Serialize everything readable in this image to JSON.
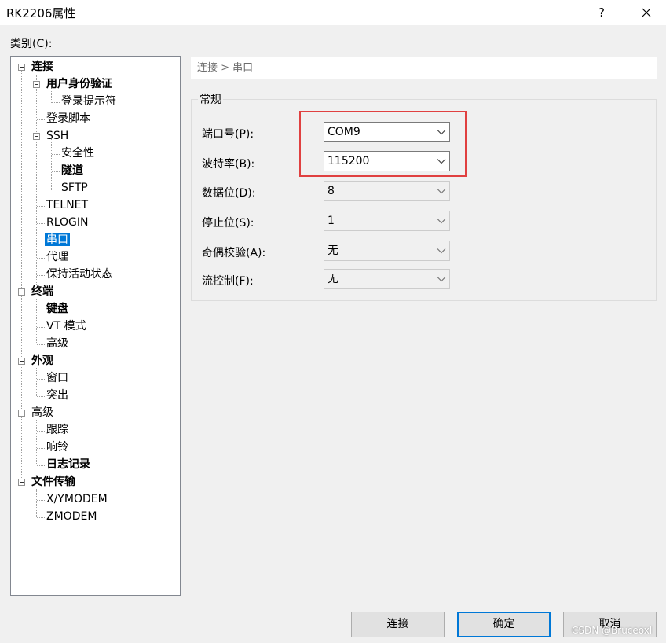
{
  "window": {
    "title": "RK2206属性",
    "help": "?"
  },
  "category_label": "类别(C):",
  "tree": [
    {
      "label": "连接",
      "bold": true
    },
    {
      "label": "用户身份验证",
      "bold": true
    },
    {
      "label": "登录提示符"
    },
    {
      "label": "登录脚本"
    },
    {
      "label": "SSH"
    },
    {
      "label": "安全性"
    },
    {
      "label": "隧道",
      "bold": true
    },
    {
      "label": "SFTP"
    },
    {
      "label": "TELNET"
    },
    {
      "label": "RLOGIN"
    },
    {
      "label": "串口",
      "selected": true
    },
    {
      "label": "代理"
    },
    {
      "label": "保持活动状态"
    },
    {
      "label": "终端",
      "bold": true
    },
    {
      "label": "键盘",
      "bold": true
    },
    {
      "label": "VT 模式"
    },
    {
      "label": "高级"
    },
    {
      "label": "外观",
      "bold": true
    },
    {
      "label": "窗口"
    },
    {
      "label": "突出"
    },
    {
      "label": "高级"
    },
    {
      "label": "跟踪"
    },
    {
      "label": "响铃"
    },
    {
      "label": "日志记录",
      "bold": true
    },
    {
      "label": "文件传输",
      "bold": true
    },
    {
      "label": "X/YMODEM"
    },
    {
      "label": "ZMODEM"
    }
  ],
  "breadcrumb": "连接 > 串口",
  "group_title": "常规",
  "fields": {
    "port": {
      "label": "端口号(P):",
      "value": "COM9"
    },
    "baud": {
      "label": "波特率(B):",
      "value": "115200"
    },
    "databits": {
      "label": "数据位(D):",
      "value": "8"
    },
    "stopbits": {
      "label": "停止位(S):",
      "value": "1"
    },
    "parity": {
      "label": "奇偶校验(A):",
      "value": "无"
    },
    "flow": {
      "label": "流控制(F):",
      "value": "无"
    }
  },
  "buttons": {
    "connect": "连接",
    "ok": "确定",
    "cancel": "取消"
  },
  "watermark": "CSDN @Bruceoxl",
  "colors": {
    "selection": "#0078d7",
    "highlight_box": "#e04040"
  }
}
